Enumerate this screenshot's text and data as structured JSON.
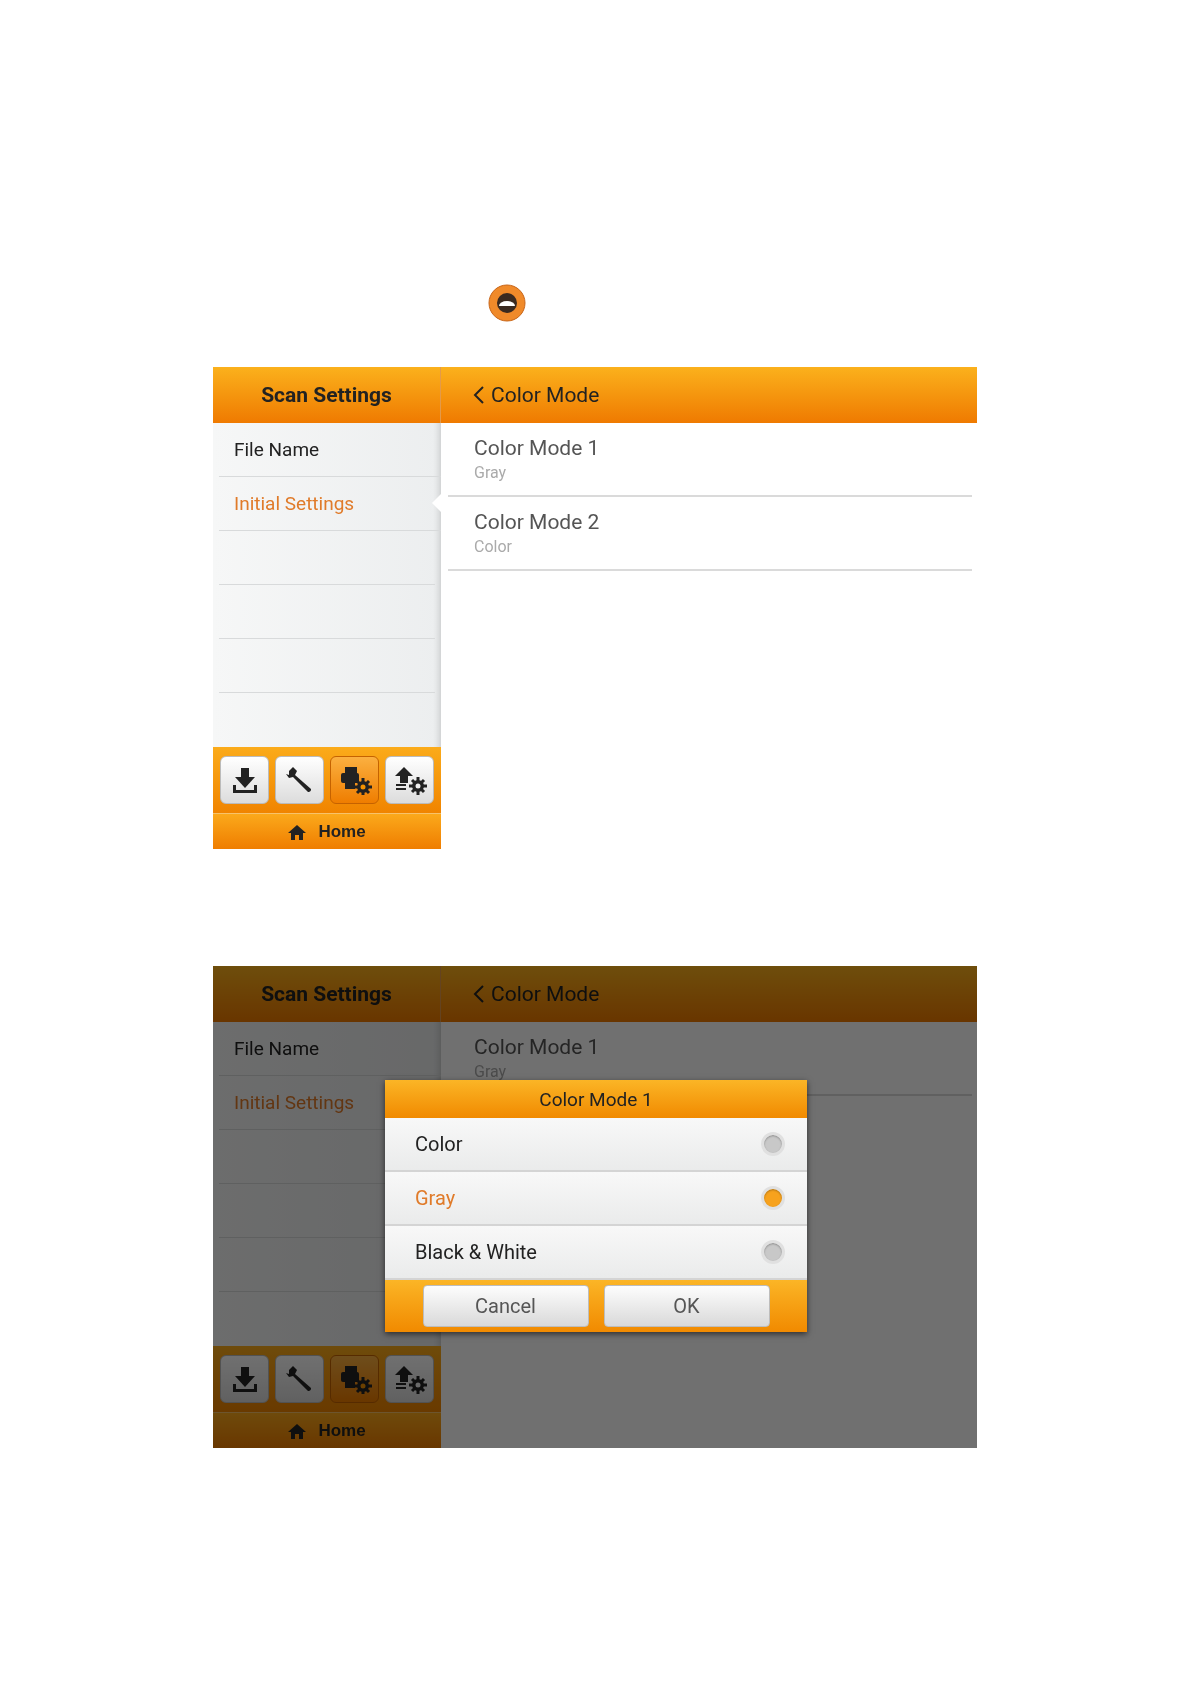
{
  "screens": [
    {
      "header": {
        "title": "Scan Settings",
        "back_title": "Color Mode"
      },
      "sidebar": {
        "items": [
          {
            "label": "File Name",
            "selected": false
          },
          {
            "label": "Initial Settings",
            "selected": true
          }
        ]
      },
      "toolbar": [
        {
          "kind": "download",
          "selected": false
        },
        {
          "kind": "tools",
          "selected": false
        },
        {
          "kind": "scanner-settings",
          "selected": true
        },
        {
          "kind": "upload-settings",
          "selected": false
        }
      ],
      "home": "Home",
      "list": [
        {
          "title": "Color Mode 1",
          "value": "Gray"
        },
        {
          "title": "Color Mode 2",
          "value": "Color"
        }
      ]
    },
    {
      "dimmed": true,
      "header": {
        "title": "Scan Settings",
        "back_title": "Color Mode"
      },
      "sidebar": {
        "items": [
          {
            "label": "File Name",
            "selected": false
          },
          {
            "label": "Initial Settings",
            "selected": true
          }
        ]
      },
      "toolbar": [
        {
          "kind": "download",
          "selected": false
        },
        {
          "kind": "tools",
          "selected": false
        },
        {
          "kind": "scanner-settings",
          "selected": true
        },
        {
          "kind": "upload-settings",
          "selected": false
        }
      ],
      "home": "Home",
      "list": [
        {
          "title": "Color Mode 1",
          "value": "Gray"
        }
      ],
      "dialog": {
        "title": "Color Mode 1",
        "options": [
          {
            "label": "Color",
            "selected": false
          },
          {
            "label": "Gray",
            "selected": true
          },
          {
            "label": "Black & White",
            "selected": false
          }
        ],
        "buttons": [
          "Cancel",
          "OK"
        ]
      }
    }
  ]
}
